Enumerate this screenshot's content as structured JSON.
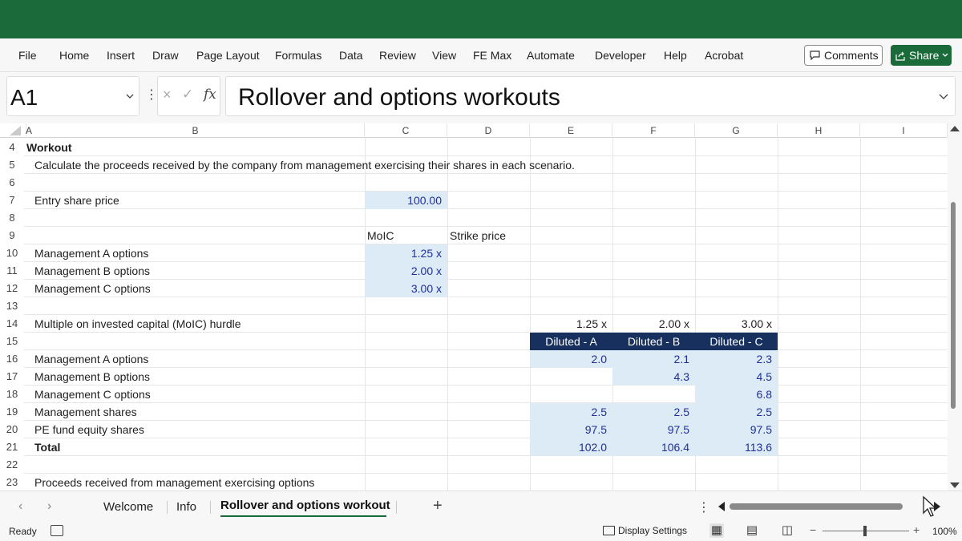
{
  "menu": [
    "File",
    "Home",
    "Insert",
    "Draw",
    "Page Layout",
    "Formulas",
    "Data",
    "Review",
    "View",
    "FE Max",
    "Automate",
    "Developer",
    "Help",
    "Acrobat"
  ],
  "buttons": {
    "comments": "Comments",
    "share": "Share"
  },
  "namebox": "A1",
  "formula_icons": {
    "cancel": "×",
    "enter": "✓",
    "fx": "fx"
  },
  "formula": "Rollover and options workouts",
  "columns": [
    "A",
    "B",
    "C",
    "D",
    "E",
    "F",
    "G",
    "H",
    "I"
  ],
  "rows": [
    "4",
    "5",
    "6",
    "7",
    "8",
    "9",
    "10",
    "11",
    "12",
    "13",
    "14",
    "15",
    "16",
    "17",
    "18",
    "19",
    "20",
    "21",
    "22",
    "23"
  ],
  "cells": {
    "workout": "Workout",
    "instruction": "Calculate the proceeds received by the company from management exercising their shares in each scenario.",
    "entry_label": "Entry share price",
    "entry_value": "100.00",
    "moic_header": "MoIC",
    "strike_header": "Strike price",
    "mgmt_a_options": "Management A options",
    "mgmt_b_options": "Management B options",
    "mgmt_c_options": "Management C options",
    "moic_a": "1.25 x",
    "moic_b": "2.00 x",
    "moic_c": "3.00 x",
    "hurdle_label": "Multiple on invested capital (MoIC) hurdle",
    "hurdle_e": "1.25 x",
    "hurdle_f": "2.00 x",
    "hurdle_g": "3.00 x",
    "diluted_a": "Diluted - A",
    "diluted_b": "Diluted - B",
    "diluted_c": "Diluted - C",
    "r16_label": "Management A options",
    "r16_e": "2.0",
    "r16_f": "2.1",
    "r16_g": "2.3",
    "r17_label": "Management B options",
    "r17_f": "4.3",
    "r17_g": "4.5",
    "r18_label": "Management C options",
    "r18_g": "6.8",
    "r19_label": "Management shares",
    "r19_e": "2.5",
    "r19_f": "2.5",
    "r19_g": "2.5",
    "r20_label": "PE fund equity shares",
    "r20_e": "97.5",
    "r20_f": "97.5",
    "r20_g": "97.5",
    "r21_label": "Total",
    "r21_e": "102.0",
    "r21_f": "106.4",
    "r21_g": "113.6",
    "r23_label": "Proceeds received from management exercising options"
  },
  "sheets": [
    {
      "label": "Welcome",
      "active": false
    },
    {
      "label": "Info",
      "active": false
    },
    {
      "label": "Rollover and options workout",
      "active": true
    }
  ],
  "status": {
    "ready": "Ready",
    "display_settings": "Display Settings",
    "zoom": "100%"
  },
  "icons": [
    "chevron-down-icon",
    "comment-icon",
    "share-icon",
    "fx-icon",
    "plus-icon",
    "accessibility-icon",
    "normal-view-icon",
    "page-layout-icon",
    "page-break-icon"
  ],
  "colors": {
    "accent": "#1b6b3a",
    "header_fill": "#17305e",
    "input_fill": "#ddebf7",
    "input_text": "#1f2f99"
  }
}
